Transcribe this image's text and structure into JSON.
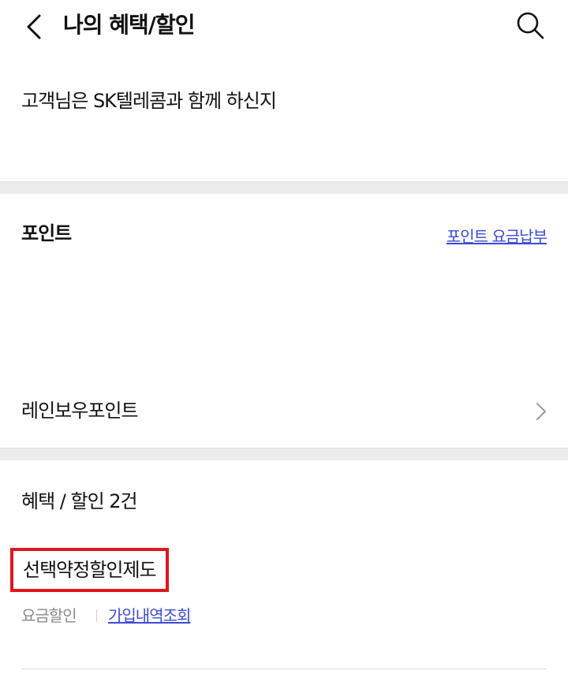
{
  "header": {
    "title": "나의 혜택/할인",
    "back_icon": "back-icon",
    "search_icon": "search-icon"
  },
  "greeting": {
    "text": "고객님은 SK텔레콤과 함께 하신지"
  },
  "points": {
    "title": "포인트",
    "link_label": "포인트 요금납부",
    "rainbow_label": "레인보우포인트",
    "row_icon": "chevron-right-icon"
  },
  "benefits": {
    "count_label": "혜택 / 할인 2건",
    "items": [
      {
        "name": "선택약정할인제도",
        "type": "요금할인",
        "link_label": "가입내역조회"
      }
    ]
  },
  "colors": {
    "link": "#3b4bd8",
    "highlight_border": "#e0161f",
    "muted_text": "#8a8a8a",
    "divider": "#ececec"
  }
}
